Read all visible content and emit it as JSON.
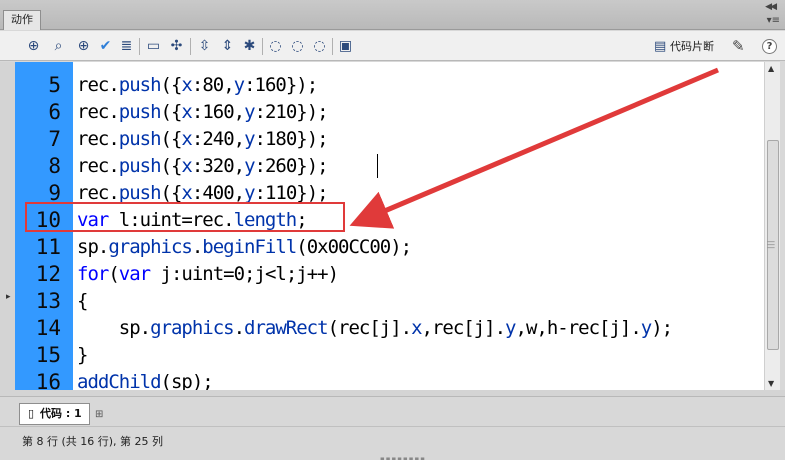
{
  "panel": {
    "title": "动作"
  },
  "toolbar": {
    "icons": [
      "add-item-icon",
      "find-icon",
      "target-icon",
      "check-syntax-icon",
      "auto-format-icon",
      "code-hint-icon",
      "debug-options-icon",
      "collapse-between-braces-icon",
      "collapse-selection-icon",
      "expand-all-icon",
      "apply-block-comment-icon",
      "apply-line-comment-icon",
      "remove-comment-icon",
      "show-hide-toolbox-icon"
    ],
    "snippets_label": "代码片断"
  },
  "editor": {
    "lines": [
      {
        "num": "5",
        "tokens": [
          [
            "rec.",
            ""
          ],
          [
            "push",
            "m"
          ],
          [
            "({",
            ""
          ],
          [
            "x",
            "m"
          ],
          [
            ":80,",
            ""
          ],
          [
            "y",
            "m"
          ],
          [
            ":160});",
            ""
          ]
        ]
      },
      {
        "num": "6",
        "tokens": [
          [
            "rec.",
            ""
          ],
          [
            "push",
            "m"
          ],
          [
            "({",
            ""
          ],
          [
            "x",
            "m"
          ],
          [
            ":160,",
            ""
          ],
          [
            "y",
            "m"
          ],
          [
            ":210});",
            ""
          ]
        ]
      },
      {
        "num": "7",
        "tokens": [
          [
            "rec.",
            ""
          ],
          [
            "push",
            "m"
          ],
          [
            "({",
            ""
          ],
          [
            "x",
            "m"
          ],
          [
            ":240,",
            ""
          ],
          [
            "y",
            "m"
          ],
          [
            ":180});",
            ""
          ]
        ]
      },
      {
        "num": "8",
        "tokens": [
          [
            "rec.",
            ""
          ],
          [
            "push",
            "m"
          ],
          [
            "({",
            ""
          ],
          [
            "x",
            "m"
          ],
          [
            ":320,",
            ""
          ],
          [
            "y",
            "m"
          ],
          [
            ":260});",
            ""
          ]
        ]
      },
      {
        "num": "9",
        "tokens": [
          [
            "rec.",
            ""
          ],
          [
            "push",
            "m"
          ],
          [
            "({",
            ""
          ],
          [
            "x",
            "m"
          ],
          [
            ":400,",
            ""
          ],
          [
            "y",
            "m"
          ],
          [
            ":110});",
            ""
          ]
        ]
      },
      {
        "num": "10",
        "tokens": [
          [
            "var",
            "k"
          ],
          [
            " l:uint=rec.",
            ""
          ],
          [
            "length",
            "m"
          ],
          [
            ";",
            ""
          ]
        ]
      },
      {
        "num": "11",
        "tokens": [
          [
            "sp.",
            ""
          ],
          [
            "graphics",
            "m"
          ],
          [
            ".",
            ""
          ],
          [
            "beginFill",
            "m"
          ],
          [
            "(0x00CC00);",
            ""
          ]
        ]
      },
      {
        "num": "12",
        "tokens": [
          [
            "for",
            "k"
          ],
          [
            "(",
            ""
          ],
          [
            "var",
            "k"
          ],
          [
            " j:uint=0;j<l;j++)",
            ""
          ]
        ]
      },
      {
        "num": "13",
        "tokens": [
          [
            "{",
            ""
          ]
        ]
      },
      {
        "num": "14",
        "tokens": [
          [
            "    sp.",
            ""
          ],
          [
            "graphics",
            "m"
          ],
          [
            ".",
            ""
          ],
          [
            "drawRect",
            "m"
          ],
          [
            "(rec[j].",
            ""
          ],
          [
            "x",
            "m"
          ],
          [
            ",rec[j].",
            ""
          ],
          [
            "y",
            "m"
          ],
          [
            ",w,h-rec[j].",
            ""
          ],
          [
            "y",
            "m"
          ],
          [
            ");",
            ""
          ]
        ]
      },
      {
        "num": "15",
        "tokens": [
          [
            "}",
            ""
          ]
        ]
      },
      {
        "num": "16",
        "tokens": [
          [
            "addChild",
            "m"
          ],
          [
            "(sp);",
            ""
          ]
        ]
      }
    ]
  },
  "tabs": {
    "code_tab_label": "代码 : 1"
  },
  "status": {
    "text": "第 8 行 (共 16 行), 第 25 列"
  },
  "colors": {
    "gutter": "#3399ff",
    "keyword": "#0000ff",
    "member": "#0033aa",
    "annotation": "#e03a3a"
  }
}
